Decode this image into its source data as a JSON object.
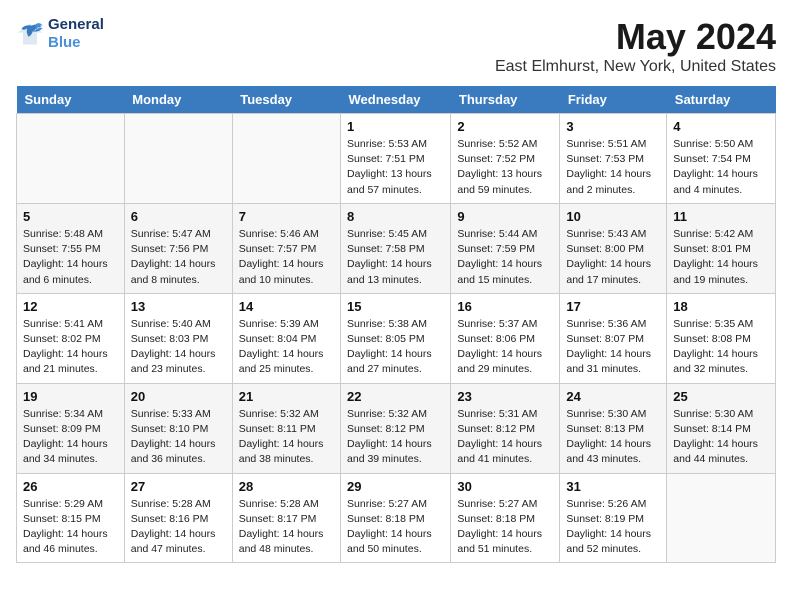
{
  "header": {
    "logo_line1": "General",
    "logo_line2": "Blue",
    "title": "May 2024",
    "subtitle": "East Elmhurst, New York, United States"
  },
  "days_of_week": [
    "Sunday",
    "Monday",
    "Tuesday",
    "Wednesday",
    "Thursday",
    "Friday",
    "Saturday"
  ],
  "weeks": [
    [
      {
        "day": "",
        "info": ""
      },
      {
        "day": "",
        "info": ""
      },
      {
        "day": "",
        "info": ""
      },
      {
        "day": "1",
        "info": "Sunrise: 5:53 AM\nSunset: 7:51 PM\nDaylight: 13 hours\nand 57 minutes."
      },
      {
        "day": "2",
        "info": "Sunrise: 5:52 AM\nSunset: 7:52 PM\nDaylight: 13 hours\nand 59 minutes."
      },
      {
        "day": "3",
        "info": "Sunrise: 5:51 AM\nSunset: 7:53 PM\nDaylight: 14 hours\nand 2 minutes."
      },
      {
        "day": "4",
        "info": "Sunrise: 5:50 AM\nSunset: 7:54 PM\nDaylight: 14 hours\nand 4 minutes."
      }
    ],
    [
      {
        "day": "5",
        "info": "Sunrise: 5:48 AM\nSunset: 7:55 PM\nDaylight: 14 hours\nand 6 minutes."
      },
      {
        "day": "6",
        "info": "Sunrise: 5:47 AM\nSunset: 7:56 PM\nDaylight: 14 hours\nand 8 minutes."
      },
      {
        "day": "7",
        "info": "Sunrise: 5:46 AM\nSunset: 7:57 PM\nDaylight: 14 hours\nand 10 minutes."
      },
      {
        "day": "8",
        "info": "Sunrise: 5:45 AM\nSunset: 7:58 PM\nDaylight: 14 hours\nand 13 minutes."
      },
      {
        "day": "9",
        "info": "Sunrise: 5:44 AM\nSunset: 7:59 PM\nDaylight: 14 hours\nand 15 minutes."
      },
      {
        "day": "10",
        "info": "Sunrise: 5:43 AM\nSunset: 8:00 PM\nDaylight: 14 hours\nand 17 minutes."
      },
      {
        "day": "11",
        "info": "Sunrise: 5:42 AM\nSunset: 8:01 PM\nDaylight: 14 hours\nand 19 minutes."
      }
    ],
    [
      {
        "day": "12",
        "info": "Sunrise: 5:41 AM\nSunset: 8:02 PM\nDaylight: 14 hours\nand 21 minutes."
      },
      {
        "day": "13",
        "info": "Sunrise: 5:40 AM\nSunset: 8:03 PM\nDaylight: 14 hours\nand 23 minutes."
      },
      {
        "day": "14",
        "info": "Sunrise: 5:39 AM\nSunset: 8:04 PM\nDaylight: 14 hours\nand 25 minutes."
      },
      {
        "day": "15",
        "info": "Sunrise: 5:38 AM\nSunset: 8:05 PM\nDaylight: 14 hours\nand 27 minutes."
      },
      {
        "day": "16",
        "info": "Sunrise: 5:37 AM\nSunset: 8:06 PM\nDaylight: 14 hours\nand 29 minutes."
      },
      {
        "day": "17",
        "info": "Sunrise: 5:36 AM\nSunset: 8:07 PM\nDaylight: 14 hours\nand 31 minutes."
      },
      {
        "day": "18",
        "info": "Sunrise: 5:35 AM\nSunset: 8:08 PM\nDaylight: 14 hours\nand 32 minutes."
      }
    ],
    [
      {
        "day": "19",
        "info": "Sunrise: 5:34 AM\nSunset: 8:09 PM\nDaylight: 14 hours\nand 34 minutes."
      },
      {
        "day": "20",
        "info": "Sunrise: 5:33 AM\nSunset: 8:10 PM\nDaylight: 14 hours\nand 36 minutes."
      },
      {
        "day": "21",
        "info": "Sunrise: 5:32 AM\nSunset: 8:11 PM\nDaylight: 14 hours\nand 38 minutes."
      },
      {
        "day": "22",
        "info": "Sunrise: 5:32 AM\nSunset: 8:12 PM\nDaylight: 14 hours\nand 39 minutes."
      },
      {
        "day": "23",
        "info": "Sunrise: 5:31 AM\nSunset: 8:12 PM\nDaylight: 14 hours\nand 41 minutes."
      },
      {
        "day": "24",
        "info": "Sunrise: 5:30 AM\nSunset: 8:13 PM\nDaylight: 14 hours\nand 43 minutes."
      },
      {
        "day": "25",
        "info": "Sunrise: 5:30 AM\nSunset: 8:14 PM\nDaylight: 14 hours\nand 44 minutes."
      }
    ],
    [
      {
        "day": "26",
        "info": "Sunrise: 5:29 AM\nSunset: 8:15 PM\nDaylight: 14 hours\nand 46 minutes."
      },
      {
        "day": "27",
        "info": "Sunrise: 5:28 AM\nSunset: 8:16 PM\nDaylight: 14 hours\nand 47 minutes."
      },
      {
        "day": "28",
        "info": "Sunrise: 5:28 AM\nSunset: 8:17 PM\nDaylight: 14 hours\nand 48 minutes."
      },
      {
        "day": "29",
        "info": "Sunrise: 5:27 AM\nSunset: 8:18 PM\nDaylight: 14 hours\nand 50 minutes."
      },
      {
        "day": "30",
        "info": "Sunrise: 5:27 AM\nSunset: 8:18 PM\nDaylight: 14 hours\nand 51 minutes."
      },
      {
        "day": "31",
        "info": "Sunrise: 5:26 AM\nSunset: 8:19 PM\nDaylight: 14 hours\nand 52 minutes."
      },
      {
        "day": "",
        "info": ""
      }
    ]
  ]
}
